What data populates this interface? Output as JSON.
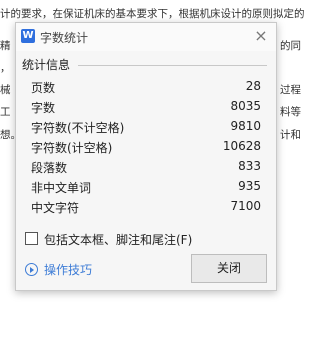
{
  "document": {
    "lines": [
      "计的要求，在保证机床的基本要求下，根据机床设计的原则拟定的",
      "精",
      "，",
      "械",
      "工",
      "想。"
    ],
    "right_fragments": [
      "的同",
      "过程",
      "料等",
      "计和"
    ]
  },
  "dialog": {
    "app_icon": "W",
    "title": "字数统计",
    "close_icon": "×",
    "section_label": "统计信息",
    "stats": [
      {
        "label": "页数",
        "value": "28"
      },
      {
        "label": "字数",
        "value": "8035"
      },
      {
        "label": "字符数(不计空格)",
        "value": "9810"
      },
      {
        "label": "字符数(计空格)",
        "value": "10628"
      },
      {
        "label": "段落数",
        "value": "833"
      },
      {
        "label": "非中文单词",
        "value": "935"
      },
      {
        "label": "中文字符",
        "value": "7100"
      }
    ],
    "checkbox_label": "包括文本框、脚注和尾注(F)",
    "checkbox_checked": false,
    "tips_label": "操作技巧",
    "close_button": "关闭"
  },
  "colors": {
    "accent": "#3d7cd6",
    "app_icon_bg": "#2f6fde"
  }
}
